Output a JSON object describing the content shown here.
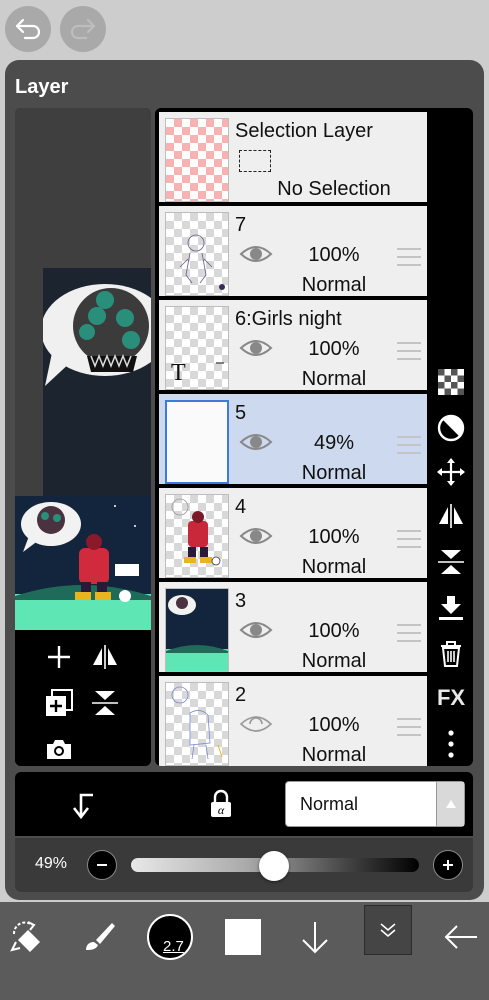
{
  "panel": {
    "title": "Layer"
  },
  "layers": [
    {
      "name": "Selection Layer",
      "status": "No Selection"
    },
    {
      "name": "7",
      "opacity": "100%",
      "blend": "Normal"
    },
    {
      "name": "6:Girls night",
      "opacity": "100%",
      "blend": "Normal",
      "thumb_text": "T"
    },
    {
      "name": "5",
      "opacity": "49%",
      "blend": "Normal"
    },
    {
      "name": "4",
      "opacity": "100%",
      "blend": "Normal"
    },
    {
      "name": "3",
      "opacity": "100%",
      "blend": "Normal"
    },
    {
      "name": "2",
      "opacity": "100%",
      "blend": "Normal"
    }
  ],
  "selected_layer": "5",
  "right_tools": {
    "fx_label": "FX"
  },
  "blend_mode": {
    "value": "Normal"
  },
  "opacity_slider": {
    "label": "49%",
    "value": 0.49
  },
  "brush": {
    "size": "2.7"
  },
  "colors": {
    "panel": "#4c4c4c",
    "selected_row": "#cdd9ee",
    "accent": "#3f7ad8"
  }
}
